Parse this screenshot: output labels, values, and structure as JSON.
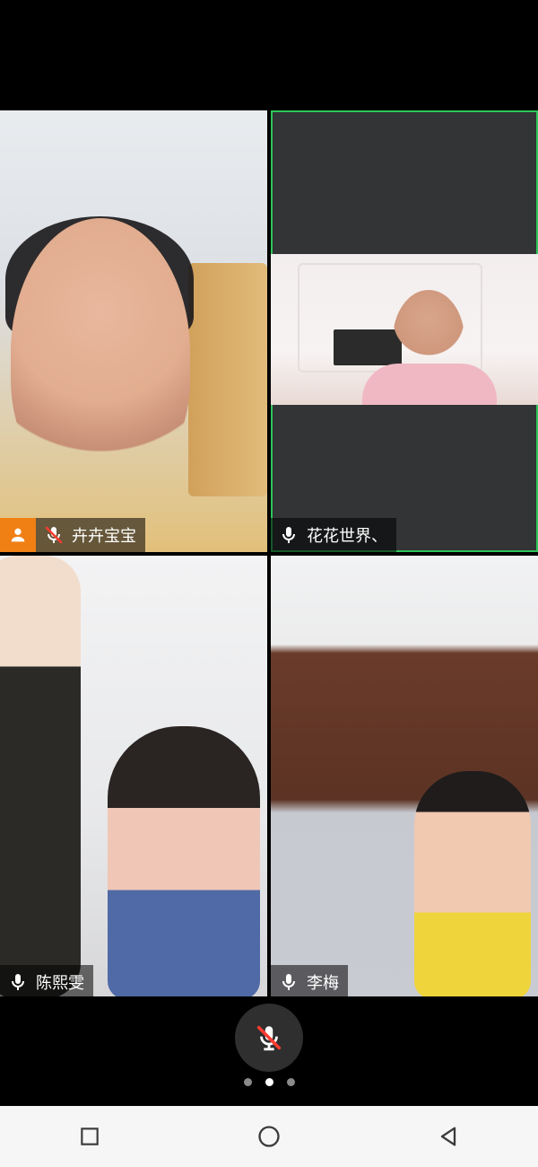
{
  "participants": [
    {
      "name": "卉卉宝宝",
      "muted": true,
      "host": true
    },
    {
      "name": "花花世界、",
      "muted": false,
      "active_speaker": true
    },
    {
      "name": "陈熙雯",
      "muted": false
    },
    {
      "name": "李梅",
      "muted": false
    }
  ],
  "controls": {
    "mic_muted": true,
    "page_index": 2,
    "page_count": 3
  },
  "colors": {
    "active_border": "#2fc55a",
    "host_badge": "#f07f14",
    "label_bg": "#000000"
  }
}
